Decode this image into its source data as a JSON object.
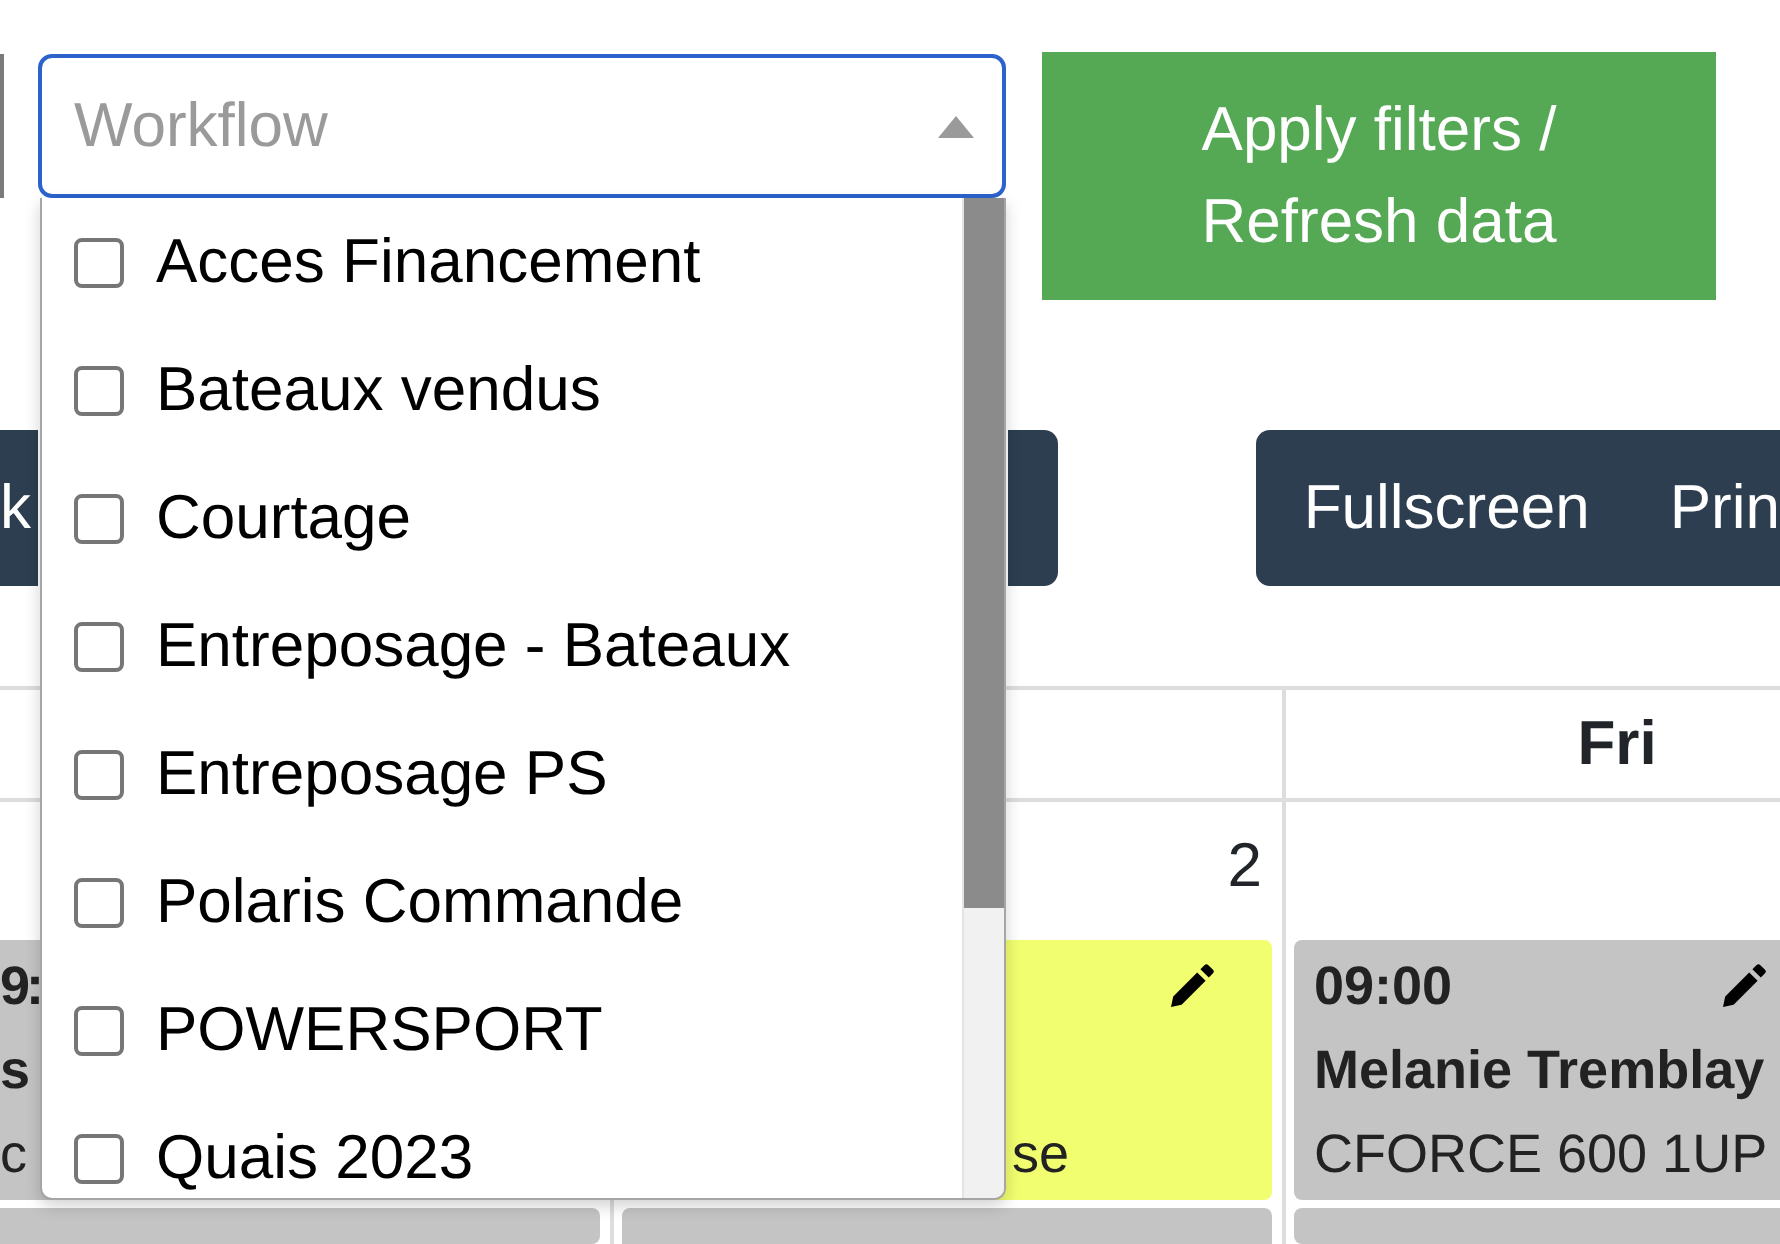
{
  "filters": {
    "workflow_select": {
      "placeholder": "Workflow",
      "expanded": true,
      "options": [
        {
          "label": "Acces Financement",
          "checked": false
        },
        {
          "label": "Bateaux vendus",
          "checked": false
        },
        {
          "label": "Courtage",
          "checked": false
        },
        {
          "label": "Entreposage - Bateaux",
          "checked": false
        },
        {
          "label": "Entreposage PS",
          "checked": false
        },
        {
          "label": "Polaris Commande",
          "checked": false
        },
        {
          "label": "POWERSPORT",
          "checked": false
        },
        {
          "label": "Quais 2023",
          "checked": false
        }
      ]
    },
    "apply_button": {
      "label": "Apply filters / Refresh data"
    }
  },
  "toolbar": {
    "left_buttons": [
      {
        "label": "k"
      }
    ],
    "right_buttons": [
      {
        "label": "Fullscreen"
      },
      {
        "label": "Prin"
      }
    ]
  },
  "calendar": {
    "columns": [
      {
        "events": [
          {
            "color": "#c4c4c4",
            "time": "9:",
            "title": "s",
            "detail": "c"
          },
          {
            "color": "#c4c4c4"
          }
        ]
      },
      {
        "day_number": "2",
        "events": [
          {
            "color": "#f1fe6f",
            "detail": "se",
            "edit_icon": true
          },
          {
            "color": "#c4c4c4"
          }
        ]
      },
      {
        "header": "Fri",
        "events": [
          {
            "color": "#c4c4c4",
            "time": "09:00",
            "title": "Melanie Tremblay",
            "detail": "CFORCE 600 1UP",
            "edit_icon": true
          },
          {
            "color": "#c4c4c4"
          }
        ]
      }
    ]
  }
}
